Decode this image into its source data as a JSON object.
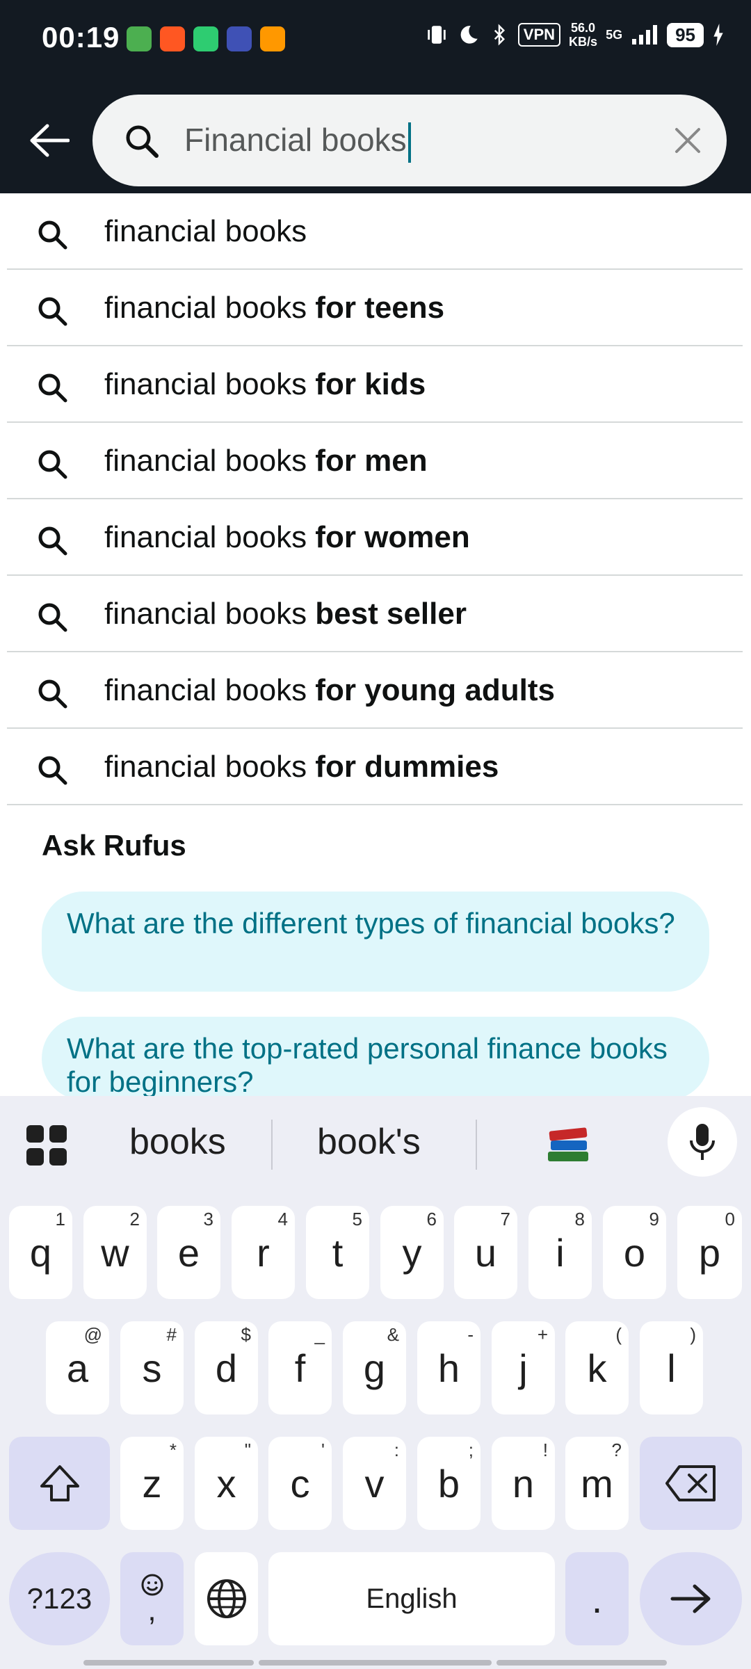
{
  "status_bar": {
    "time": "00:19",
    "vpn": "VPN",
    "net_speed_value": "56.0",
    "net_speed_unit": "KB/s",
    "network": "5G",
    "battery": "95"
  },
  "search": {
    "value": "Financial books",
    "back_label": "Back"
  },
  "suggestions": [
    {
      "base": "financial books",
      "bold": ""
    },
    {
      "base": "financial books ",
      "bold": "for teens"
    },
    {
      "base": "financial books ",
      "bold": "for kids"
    },
    {
      "base": "financial books ",
      "bold": "for men"
    },
    {
      "base": "financial books ",
      "bold": "for women"
    },
    {
      "base": "financial books ",
      "bold": "best seller"
    },
    {
      "base": "financial books ",
      "bold": "for young adults"
    },
    {
      "base": "financial books ",
      "bold": "for dummies"
    }
  ],
  "rufus": {
    "title": "Ask Rufus",
    "questions": [
      "What are the different types of financial books?",
      "What are the top-rated personal finance books for beginners?"
    ]
  },
  "keyboard": {
    "suggestions": [
      "books",
      "book's"
    ],
    "row1": [
      {
        "k": "q",
        "h": "1"
      },
      {
        "k": "w",
        "h": "2"
      },
      {
        "k": "e",
        "h": "3"
      },
      {
        "k": "r",
        "h": "4"
      },
      {
        "k": "t",
        "h": "5"
      },
      {
        "k": "y",
        "h": "6"
      },
      {
        "k": "u",
        "h": "7"
      },
      {
        "k": "i",
        "h": "8"
      },
      {
        "k": "o",
        "h": "9"
      },
      {
        "k": "p",
        "h": "0"
      }
    ],
    "row2": [
      {
        "k": "a",
        "h": "@"
      },
      {
        "k": "s",
        "h": "#"
      },
      {
        "k": "d",
        "h": "$"
      },
      {
        "k": "f",
        "h": "_"
      },
      {
        "k": "g",
        "h": "&"
      },
      {
        "k": "h",
        "h": "-"
      },
      {
        "k": "j",
        "h": "+"
      },
      {
        "k": "k",
        "h": "("
      },
      {
        "k": "l",
        "h": ")"
      }
    ],
    "row3": [
      {
        "k": "z",
        "h": "*"
      },
      {
        "k": "x",
        "h": "\""
      },
      {
        "k": "c",
        "h": "'"
      },
      {
        "k": "v",
        "h": ":"
      },
      {
        "k": "b",
        "h": ";"
      },
      {
        "k": "n",
        "h": "!"
      },
      {
        "k": "m",
        "h": "?"
      }
    ],
    "symbols_label": "?123",
    "space_label": "English",
    "period_label": ".",
    "comma_label": ","
  },
  "colors": {
    "header_bg": "#131a22",
    "accent_teal": "#007185",
    "chip_bg": "#dff7fb",
    "keyboard_bg": "#edeef5"
  }
}
